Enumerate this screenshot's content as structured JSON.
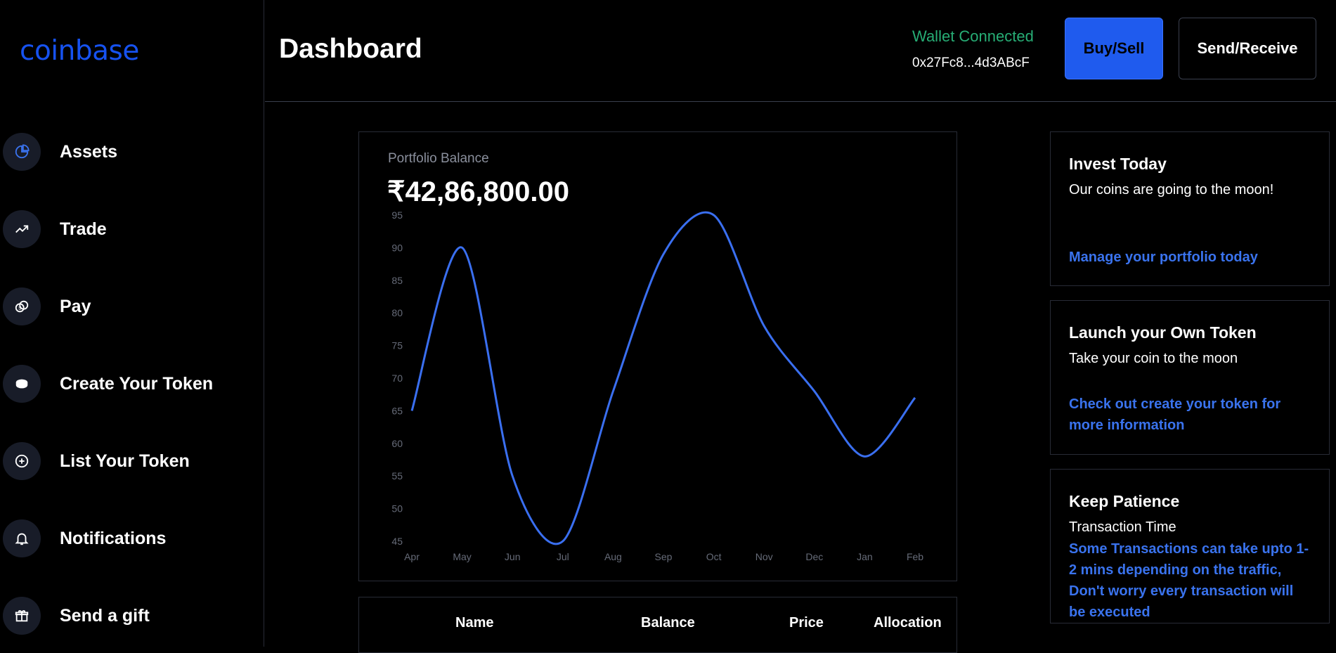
{
  "app": {
    "logo": "coinbase"
  },
  "sidebar": {
    "items": [
      {
        "label": "Assets",
        "icon": "pie-chart-icon"
      },
      {
        "label": "Trade",
        "icon": "trend-up-icon"
      },
      {
        "label": "Pay",
        "icon": "coins-icon"
      },
      {
        "label": "Create Your Token",
        "icon": "token-disc-icon"
      },
      {
        "label": "List Your Token",
        "icon": "plus-circle-icon"
      },
      {
        "label": "Notifications",
        "icon": "bell-icon"
      },
      {
        "label": "Send a gift",
        "icon": "gift-icon"
      }
    ]
  },
  "header": {
    "title": "Dashboard",
    "wallet_status": "Wallet Connected",
    "wallet_address": "0x27Fc8...4d3ABcF",
    "buy_sell_label": "Buy/Sell",
    "send_receive_label": "Send/Receive"
  },
  "portfolio": {
    "label": "Portfolio Balance",
    "balance": "₹42,86,800.00"
  },
  "chart_data": {
    "type": "line",
    "categories": [
      "Apr",
      "May",
      "Jun",
      "Jul",
      "Aug",
      "Sep",
      "Oct",
      "Nov",
      "Dec",
      "Jan",
      "Feb"
    ],
    "series": [
      {
        "values": [
          65,
          90,
          55,
          45,
          68,
          89,
          95,
          78,
          68,
          58,
          67
        ]
      }
    ],
    "ylim": [
      45,
      95
    ],
    "yticks": [
      95,
      90,
      85,
      80,
      75,
      70,
      65,
      60,
      55,
      50,
      45
    ],
    "grid": false,
    "line_color": "#3a6ff0"
  },
  "table": {
    "headers": [
      "Name",
      "Balance",
      "Price",
      "Allocation"
    ]
  },
  "promos": [
    {
      "title": "Invest Today",
      "text": "Our coins are going to the moon!",
      "link": "Manage your portfolio today"
    },
    {
      "title": "Launch your Own Token",
      "text": "Take your coin to the moon",
      "link": "Check out create your token for more information"
    },
    {
      "title": "Keep Patience",
      "text": "Transaction Time",
      "link": "Some Transactions can take upto 1-2 mins depending on the traffic, Don't worry every transaction will be executed"
    }
  ],
  "colors": {
    "accent": "#1652f0",
    "success": "#27ad75",
    "link": "#3a73ee"
  }
}
